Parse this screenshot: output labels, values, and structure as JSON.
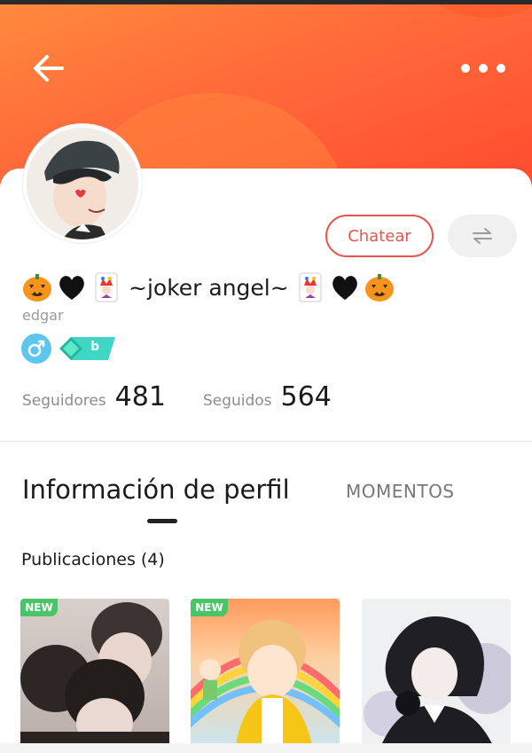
{
  "header": {
    "back_icon": "arrow-left-icon",
    "more_icon": "more-horizontal-icon"
  },
  "profile": {
    "nickname_emojis_left": [
      "jack-o-lantern-icon",
      "black-heart-icon",
      "joker-card-icon"
    ],
    "nickname": "~joker angel~",
    "nickname_emojis_right": [
      "joker-card-icon",
      "black-heart-icon",
      "jack-o-lantern-icon"
    ],
    "username": "edgar",
    "gender_icon": "male-sign-icon",
    "level_badge": "b",
    "colors": {
      "accent": "#e8564c",
      "header_start": "#ff8a3c",
      "header_end": "#ff4b2f",
      "gender_badge": "#5cc6ee",
      "level_badge": "#2fd0b0",
      "new_badge": "#49c466"
    }
  },
  "actions": {
    "chat_label": "Chatear",
    "swap_icon": "swap-arrows-icon"
  },
  "stats": {
    "followers_label": "Seguidores",
    "followers_value": "481",
    "following_label": "Seguidos",
    "following_value": "564"
  },
  "tabs": {
    "info_label": "Información de perfil",
    "moments_label": "MOMENTOS",
    "active": "info"
  },
  "posts": {
    "title": "Publicaciones (4)",
    "items": [
      {
        "badge": "NEW"
      },
      {
        "badge": "NEW"
      },
      {
        "badge": ""
      }
    ]
  }
}
